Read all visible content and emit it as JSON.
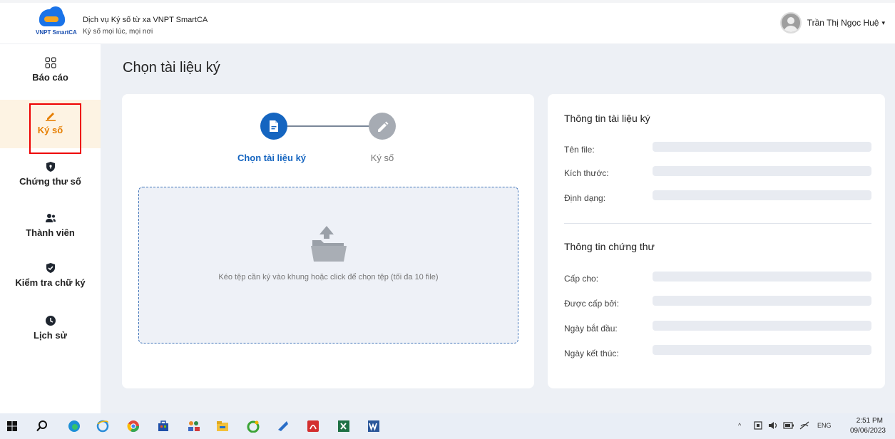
{
  "header": {
    "logo_text": "VNPT SmartCA",
    "service_title": "Dịch vụ Ký số từ xa VNPT SmartCA",
    "service_subtitle": "Ký số mọi lúc, mọi nơi",
    "user_name": "Trần Thị Ngọc Huệ",
    "user_caret": "▾"
  },
  "sidebar": {
    "items": [
      {
        "label": "Báo cáo",
        "icon": "grid-icon"
      },
      {
        "label": "Ký số",
        "icon": "pen-icon",
        "active": true
      },
      {
        "label": "Chứng thư số",
        "icon": "shield-icon"
      },
      {
        "label": "Thành viên",
        "icon": "users-icon"
      },
      {
        "label": "Kiểm tra chữ ký",
        "icon": "shield-check-icon"
      },
      {
        "label": "Lịch sử",
        "icon": "clock-icon"
      }
    ]
  },
  "main": {
    "page_title": "Chọn tài liệu ký",
    "steps": [
      {
        "label": "Chọn tài liệu ký",
        "icon": "document-icon",
        "active": true
      },
      {
        "label": "Ký số",
        "icon": "pen-icon",
        "active": false
      }
    ],
    "dropzone_text": "Kéo tệp cần ký vào khung hoặc click để chọn tệp (tối đa 10 file)"
  },
  "doc_info": {
    "title": "Thông tin tài liệu ký",
    "fields": [
      "Tên file:",
      "Kích thước:",
      "Định dạng:"
    ]
  },
  "cert_info": {
    "title": "Thông tin chứng thư",
    "fields": [
      "Cấp cho:",
      "Được cấp bởi:",
      "Ngày bắt đầu:",
      "Ngày kết thúc:"
    ]
  },
  "taskbar": {
    "language": "ENG",
    "time": "2:51 PM",
    "date": "09/06/2023",
    "tray_up_arrow": "^"
  },
  "colors": {
    "accent": "#1565c0",
    "active_orange": "#e67e00",
    "highlight_red": "#e00000",
    "background": "#edf0f5"
  }
}
